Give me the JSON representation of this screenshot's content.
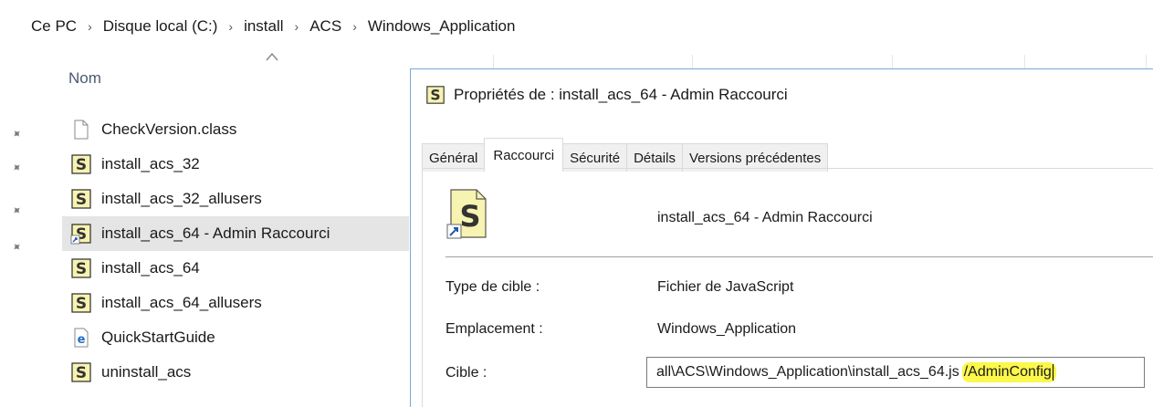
{
  "breadcrumb": [
    "Ce PC",
    "Disque local (C:)",
    "install",
    "ACS",
    "Windows_Application"
  ],
  "file_list": {
    "column_header": "Nom",
    "items": [
      {
        "name": "CheckVersion.class",
        "icon": "blank-file-icon"
      },
      {
        "name": "install_acs_32",
        "icon": "script-icon"
      },
      {
        "name": "install_acs_32_allusers",
        "icon": "script-icon"
      },
      {
        "name": "install_acs_64 - Admin Raccourci",
        "icon": "script-shortcut-icon",
        "selected": true
      },
      {
        "name": "install_acs_64",
        "icon": "script-icon"
      },
      {
        "name": "install_acs_64_allusers",
        "icon": "script-icon"
      },
      {
        "name": "QuickStartGuide",
        "icon": "html-file-icon"
      },
      {
        "name": "uninstall_acs",
        "icon": "script-icon"
      }
    ]
  },
  "dialog": {
    "title": "Propriétés de : install_acs_64 - Admin Raccourci",
    "tabs": [
      "Général",
      "Raccourci",
      "Sécurité",
      "Détails",
      "Versions précédentes"
    ],
    "active_tab": "Raccourci",
    "shortcut_name": "install_acs_64 - Admin Raccourci",
    "type_label": "Type de cible :",
    "type_value": "Fichier de JavaScript",
    "location_label": "Emplacement :",
    "location_value": "Windows_Application",
    "target_label": "Cible :",
    "target_value": "all\\ACS\\Windows_Application\\install_acs_64.js",
    "target_highlight": "/AdminConfig"
  },
  "colors": {
    "selection": "#e5e5e5",
    "highlight": "#fbf74b",
    "dialog_border": "#7aa7d8"
  }
}
